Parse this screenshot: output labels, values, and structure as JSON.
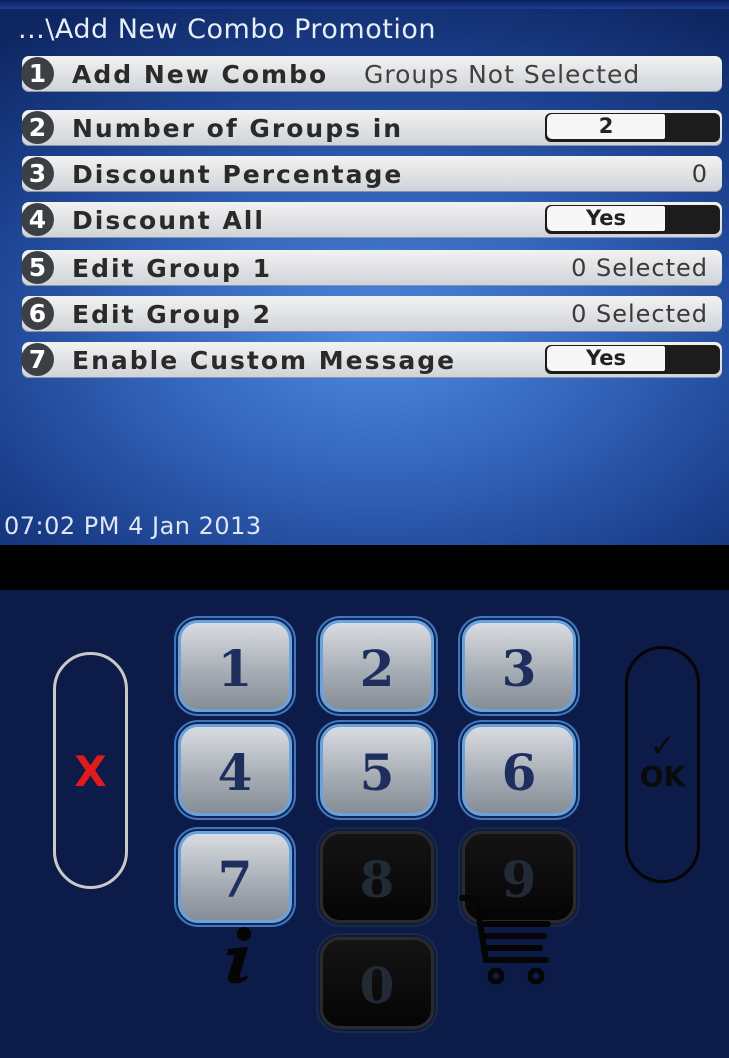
{
  "screen": {
    "title": "...\\Add New Combo Promotion",
    "timestamp": "07:02 PM 4 Jan 2013"
  },
  "menu": [
    {
      "num": "1",
      "label": "Add New Combo",
      "value": "Groups Not Selected"
    },
    {
      "num": "2",
      "label": "Number of Groups in",
      "value": "2"
    },
    {
      "num": "3",
      "label": "Discount Percentage",
      "value": "0"
    },
    {
      "num": "4",
      "label": "Discount All",
      "value": "Yes"
    },
    {
      "num": "5",
      "label": "Edit Group 1",
      "value": "0 Selected"
    },
    {
      "num": "6",
      "label": "Edit Group 2",
      "value": "0 Selected"
    },
    {
      "num": "7",
      "label": "Enable Custom Message",
      "value": "Yes"
    }
  ],
  "keypad": {
    "keys": [
      "1",
      "2",
      "3",
      "4",
      "5",
      "6",
      "7",
      "8",
      "9",
      "0"
    ],
    "disabled": [
      "8",
      "9",
      "0"
    ],
    "cancel_label": "X",
    "ok_label": "OK",
    "ok_check": "✓",
    "info_icon": "info-icon",
    "cart_icon": "cart-icon"
  },
  "colors": {
    "screen_bg": "#3466bd",
    "key_border": "#6aa2e0",
    "cancel": "#e01b1b",
    "pad_bg": "#0c1b47"
  }
}
